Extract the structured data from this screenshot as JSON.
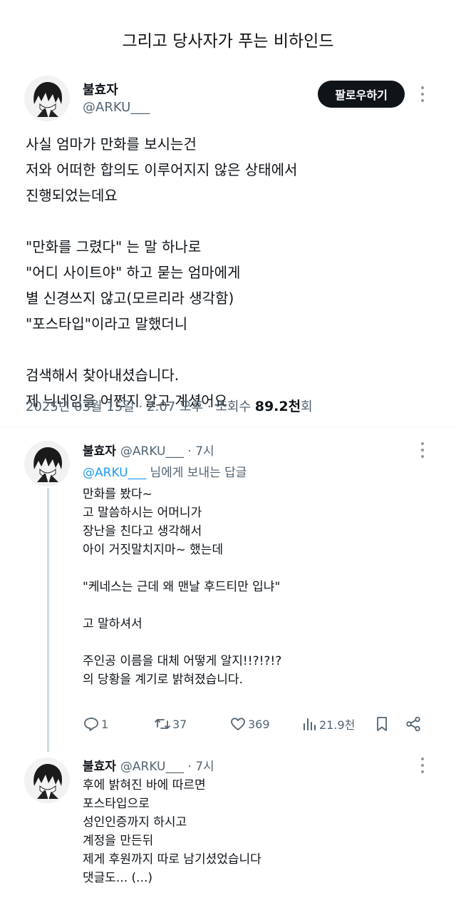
{
  "header": {
    "title": "그리고 당사자가 푸는 비하인드"
  },
  "main_tweet": {
    "name": "불효자",
    "handle": "@ARKU___",
    "follow_label": "팔로우하기",
    "body": [
      "사실 엄마가 만화를 보시는건",
      "저와 어떠한 합의도 이루어지지 않은 상태에서",
      "진행되었는데요",
      "",
      "\"만화를 그렸다\" 는 말 하나로",
      "\"어디 사이트야\" 하고 묻는 엄마에게",
      "별 신경쓰지 않고(모르리라 생각함)",
      "\"포스타입\"이라고 말했더니",
      "",
      "검색해서 찾아내셨습니다.",
      "제 닉네임을 어쩐지 알고 계셨어요"
    ],
    "timestamp": "2025년 03월 15일 · 2:07 오후 · 조회수 ",
    "views": "89.2천",
    "views_unit": "회"
  },
  "reply1": {
    "name": "불효자",
    "handle": "@ARKU___",
    "time": "· 7시",
    "reply_to_mention": "@ARKU___",
    "reply_to_suffix": " 님에게 보내는 답글",
    "body": [
      "만화를 봤다~",
      "고 말씀하시는 어머니가",
      "장난을 친다고 생각해서",
      "아이 거짓말치지마~ 했는데",
      "",
      "\"케네스는 근데 왜 맨날 후드티만 입냐\"",
      "",
      "고 말하셔서",
      "",
      "주인공 이름을 대체 어떻게 알지!!?!?!?",
      "의 당황을 계기로 밝혀졌습니다."
    ],
    "stats": {
      "replies": "1",
      "retweets": "37",
      "likes": "369",
      "views": "21.9천"
    }
  },
  "reply2": {
    "name": "불효자",
    "handle": "@ARKU___",
    "time": "· 7시",
    "body": [
      "후에 밝혀진 바에 따르면",
      "포스타입으로",
      "성인인증까지 하시고",
      "계정을 만든뒤",
      "제게 후원까지 따로 남기셨었습니다",
      "댓글도... (...)"
    ]
  }
}
